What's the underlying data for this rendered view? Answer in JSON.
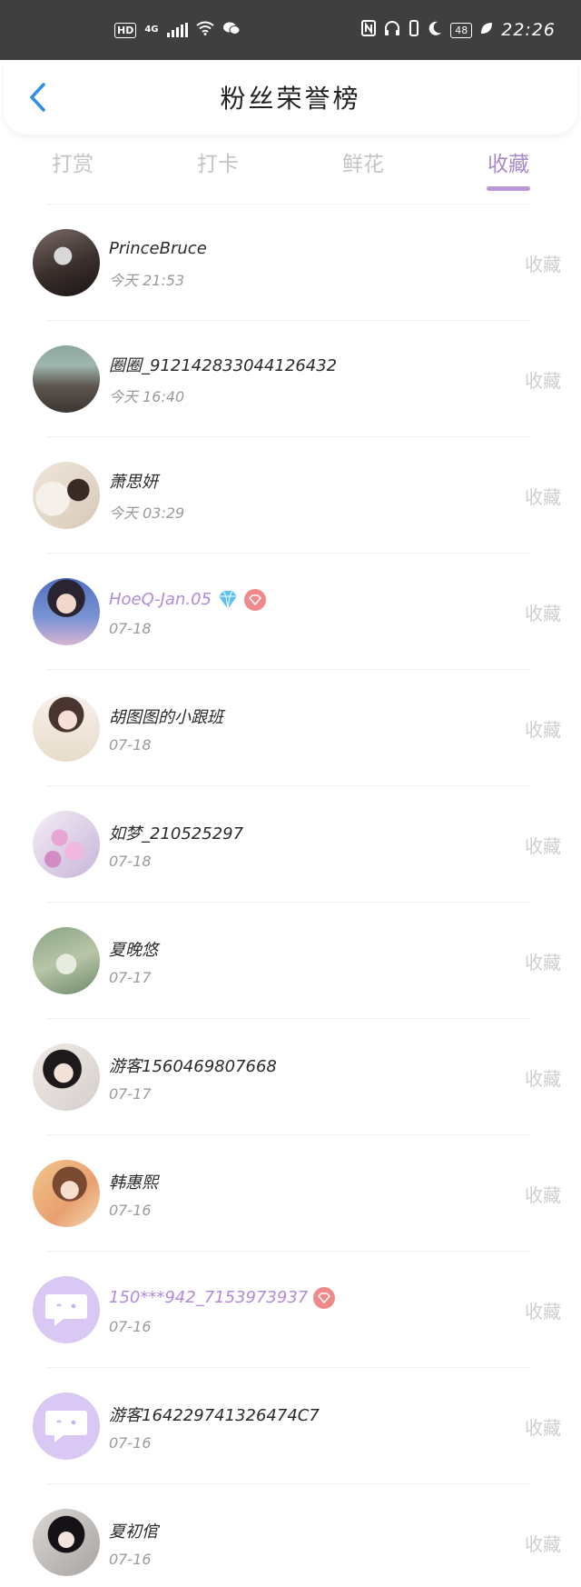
{
  "status_bar": {
    "hd": "HD",
    "network": "4G",
    "time": "22:26",
    "battery": "48"
  },
  "header": {
    "title": "粉丝荣誉榜",
    "back_icon": "chevron-left-icon",
    "accent_color": "#2f8fe8"
  },
  "tabs": [
    {
      "label": "打赏",
      "active": false
    },
    {
      "label": "打卡",
      "active": false
    },
    {
      "label": "鲜花",
      "active": false
    },
    {
      "label": "收藏",
      "active": true
    }
  ],
  "list": [
    {
      "name": "PrinceBruce",
      "time": "今天 21:53",
      "action": "收藏",
      "vip": false,
      "gem": false,
      "badge": false,
      "avatar": "photo"
    },
    {
      "name": "圈圈_912142833044126432",
      "time": "今天 16:40",
      "action": "收藏",
      "vip": false,
      "gem": false,
      "badge": false,
      "avatar": "photo"
    },
    {
      "name": "萧思妍",
      "time": "今天 03:29",
      "action": "收藏",
      "vip": false,
      "gem": false,
      "badge": false,
      "avatar": "photo"
    },
    {
      "name": "HoeQ-Jan.05",
      "time": "07-18",
      "action": "收藏",
      "vip": true,
      "gem": true,
      "badge": true,
      "avatar": "photo"
    },
    {
      "name": "胡图图的小跟班",
      "time": "07-18",
      "action": "收藏",
      "vip": false,
      "gem": false,
      "badge": false,
      "avatar": "photo"
    },
    {
      "name": "如梦_210525297",
      "time": "07-18",
      "action": "收藏",
      "vip": false,
      "gem": false,
      "badge": false,
      "avatar": "photo"
    },
    {
      "name": "夏晚悠",
      "time": "07-17",
      "action": "收藏",
      "vip": false,
      "gem": false,
      "badge": false,
      "avatar": "photo"
    },
    {
      "name": "游客1560469807668",
      "time": "07-17",
      "action": "收藏",
      "vip": false,
      "gem": false,
      "badge": false,
      "avatar": "photo"
    },
    {
      "name": "韩惠熙",
      "time": "07-16",
      "action": "收藏",
      "vip": false,
      "gem": false,
      "badge": false,
      "avatar": "photo"
    },
    {
      "name": "150***942_7153973937",
      "time": "07-16",
      "action": "收藏",
      "vip": true,
      "gem": false,
      "badge": true,
      "avatar": "default"
    },
    {
      "name": "游客164229741326474C7",
      "time": "07-16",
      "action": "收藏",
      "vip": false,
      "gem": false,
      "badge": false,
      "avatar": "default"
    },
    {
      "name": "夏初倌",
      "time": "07-16",
      "action": "收藏",
      "vip": false,
      "gem": false,
      "badge": false,
      "avatar": "photo"
    }
  ],
  "colors": {
    "tab_active": "#a98ac9",
    "vip_name": "#b08ad6",
    "badge": "#f08a8a",
    "default_avatar": "#d9c8f3"
  }
}
